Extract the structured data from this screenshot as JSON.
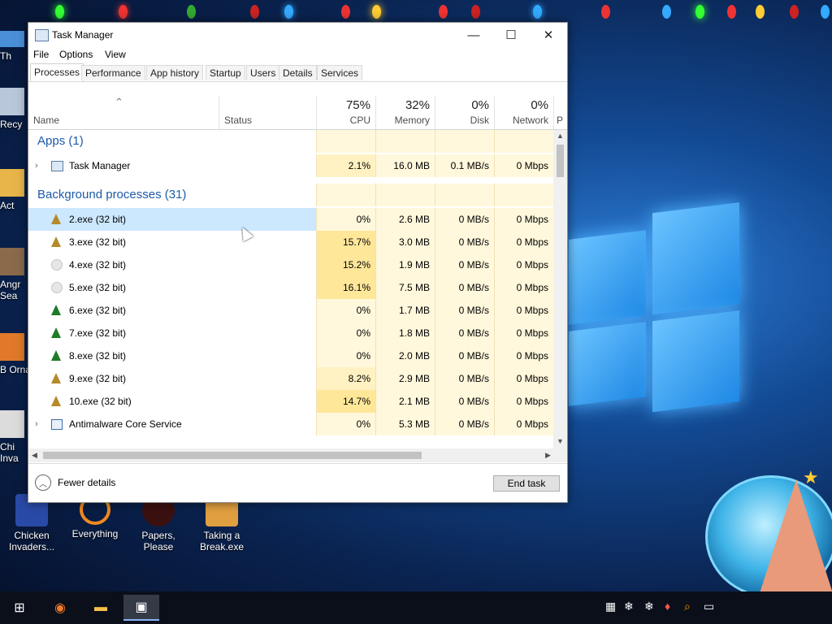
{
  "window": {
    "title": "Task Manager",
    "menu": [
      "File",
      "Options",
      "View"
    ],
    "tabs": [
      "Processes",
      "Performance",
      "App history",
      "Startup",
      "Users",
      "Details",
      "Services"
    ],
    "selected_tab": "Processes"
  },
  "columns": {
    "name": "Name",
    "status": "Status",
    "cpu": {
      "pct": "75%",
      "label": "CPU"
    },
    "memory": {
      "pct": "32%",
      "label": "Memory"
    },
    "disk": {
      "pct": "0%",
      "label": "Disk"
    },
    "network": {
      "pct": "0%",
      "label": "Network"
    },
    "partial": "P"
  },
  "groups": {
    "apps": "Apps (1)",
    "background": "Background processes (31)"
  },
  "apps": [
    {
      "name": "Task Manager",
      "cpu": "2.1%",
      "memory": "16.0 MB",
      "disk": "0.1 MB/s",
      "network": "0 Mbps",
      "icon": "task-manager-icon"
    }
  ],
  "processes": [
    {
      "name": "2.exe (32 bit)",
      "cpu": "0%",
      "memory": "2.6 MB",
      "disk": "0 MB/s",
      "network": "0 Mbps",
      "icon": "tree-icon"
    },
    {
      "name": "3.exe (32 bit)",
      "cpu": "15.7%",
      "memory": "3.0 MB",
      "disk": "0 MB/s",
      "network": "0 Mbps",
      "icon": "tree-icon"
    },
    {
      "name": "4.exe (32 bit)",
      "cpu": "15.2%",
      "memory": "1.9 MB",
      "disk": "0 MB/s",
      "network": "0 Mbps",
      "icon": "snowflake-icon"
    },
    {
      "name": "5.exe (32 bit)",
      "cpu": "16.1%",
      "memory": "7.5 MB",
      "disk": "0 MB/s",
      "network": "0 Mbps",
      "icon": "snowflake-icon"
    },
    {
      "name": "6.exe (32 bit)",
      "cpu": "0%",
      "memory": "1.7 MB",
      "disk": "0 MB/s",
      "network": "0 Mbps",
      "icon": "elf-icon"
    },
    {
      "name": "7.exe (32 bit)",
      "cpu": "0%",
      "memory": "1.8 MB",
      "disk": "0 MB/s",
      "network": "0 Mbps",
      "icon": "elf-icon"
    },
    {
      "name": "8.exe (32 bit)",
      "cpu": "0%",
      "memory": "2.0 MB",
      "disk": "0 MB/s",
      "network": "0 Mbps",
      "icon": "elf-icon"
    },
    {
      "name": "9.exe (32 bit)",
      "cpu": "8.2%",
      "memory": "2.9 MB",
      "disk": "0 MB/s",
      "network": "0 Mbps",
      "icon": "tree-icon"
    },
    {
      "name": "10.exe (32 bit)",
      "cpu": "14.7%",
      "memory": "2.1 MB",
      "disk": "0 MB/s",
      "network": "0 Mbps",
      "icon": "tree-icon"
    },
    {
      "name": "Antimalware Core Service",
      "cpu": "0%",
      "memory": "5.3 MB",
      "disk": "0 MB/s",
      "network": "0 Mbps",
      "icon": "service-icon"
    }
  ],
  "footer": {
    "fewer_details": "Fewer details",
    "end_task": "End task"
  },
  "desktop": {
    "bottom_icons": [
      "Chicken Invaders...",
      "Everything",
      "Papers, Please",
      "Taking a Break.exe"
    ],
    "edge_labels": [
      "Th",
      "Recy",
      "Act",
      "Angr Sea",
      "B Orna",
      "Chi Inva"
    ]
  },
  "colors": {
    "cpu_heat_high": "#ffe79a",
    "cpu_heat_mid": "#fff1c2",
    "cell_bg": "#fff8dc",
    "selected_row": "#cce8ff",
    "group_text": "#1e5aa8"
  }
}
